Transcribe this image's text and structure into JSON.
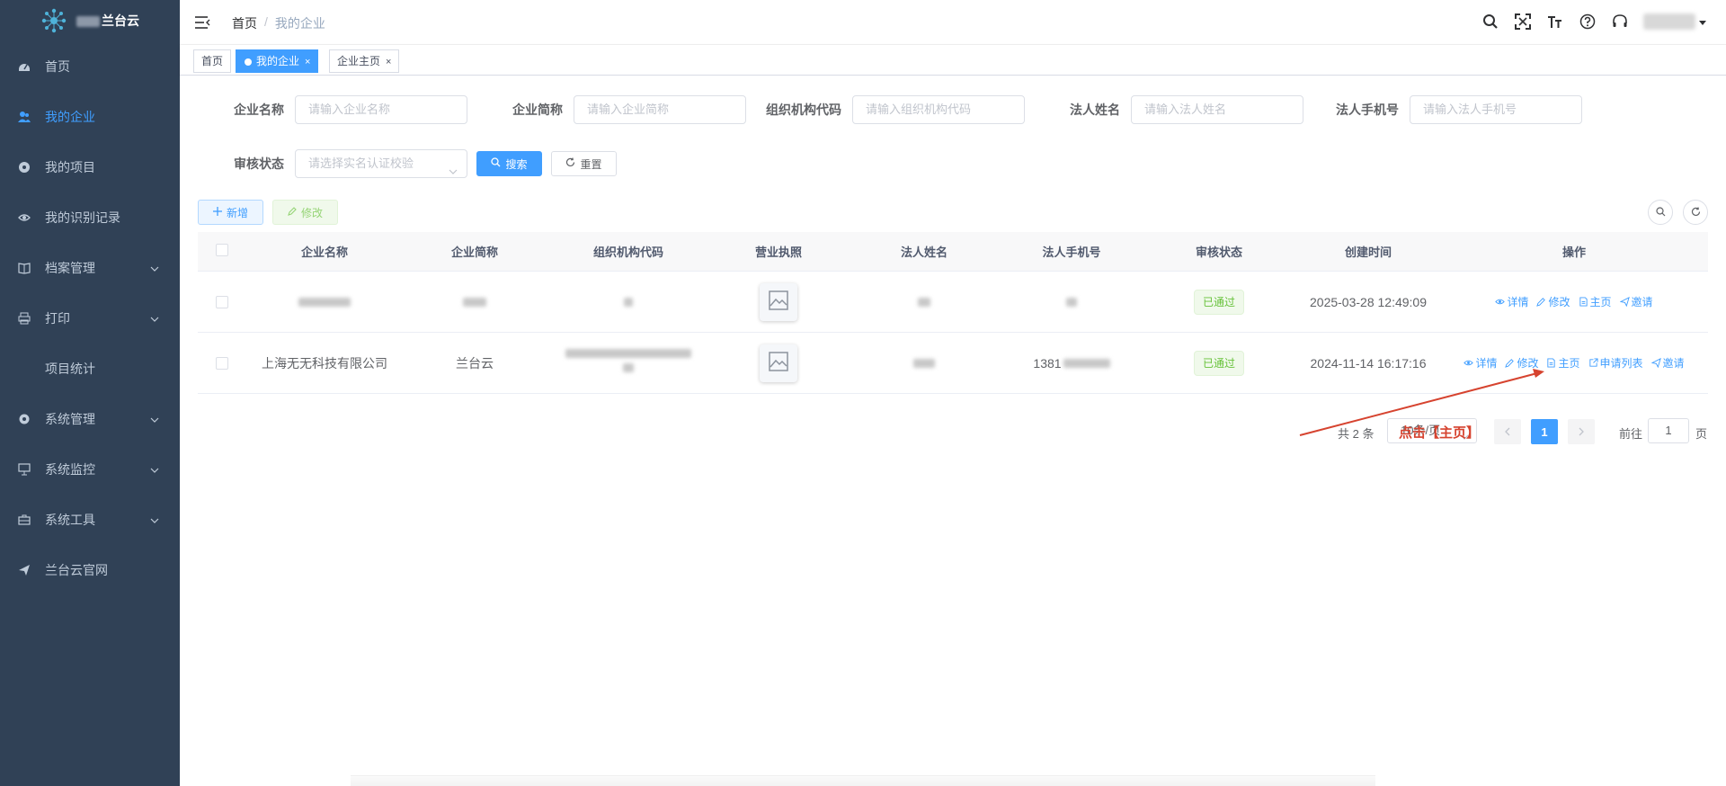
{
  "app": {
    "name": "兰台云"
  },
  "sidebar": {
    "items": [
      {
        "label": "首页",
        "icon": "dashboard-icon"
      },
      {
        "label": "我的企业",
        "icon": "users-icon"
      },
      {
        "label": "我的项目",
        "icon": "project-icon"
      },
      {
        "label": "我的识别记录",
        "icon": "eye-icon"
      },
      {
        "label": "档案管理",
        "icon": "book-icon"
      },
      {
        "label": "打印",
        "icon": "printer-icon"
      },
      {
        "label": "项目统计",
        "icon": ""
      },
      {
        "label": "系统管理",
        "icon": "gear-icon"
      },
      {
        "label": "系统监控",
        "icon": "monitor-icon"
      },
      {
        "label": "系统工具",
        "icon": "toolbox-icon"
      },
      {
        "label": "兰台云官网",
        "icon": "send-icon"
      }
    ]
  },
  "navbar": {
    "breadcrumb": [
      "首页",
      "/",
      "我的企业"
    ]
  },
  "tags": [
    {
      "label": "首页"
    },
    {
      "label": "我的企业",
      "close": "×"
    },
    {
      "label": "企业主页",
      "close": "×"
    }
  ],
  "search": {
    "fields": [
      {
        "label": "企业名称",
        "placeholder": "请输入企业名称"
      },
      {
        "label": "企业简称",
        "placeholder": "请输入企业简称"
      },
      {
        "label": "组织机构代码",
        "placeholder": "请输入组织机构代码"
      },
      {
        "label": "法人姓名",
        "placeholder": "请输入法人姓名"
      },
      {
        "label": "法人手机号",
        "placeholder": "请输入法人手机号"
      }
    ],
    "status_label": "审核状态",
    "status_placeholder": "请选择实名认证校验",
    "search_btn": "搜索",
    "reset_btn": "重置"
  },
  "toolbar": {
    "add": "新增",
    "edit": "修改"
  },
  "table": {
    "columns": [
      "企业名称",
      "企业简称",
      "组织机构代码",
      "营业执照",
      "法人姓名",
      "法人手机号",
      "审核状态",
      "创建时间",
      "操作"
    ],
    "rows": [
      {
        "name": "",
        "short": "",
        "code": "",
        "person": "",
        "phone": "",
        "status": "已通过",
        "created": "2025-03-28 12:49:09",
        "ops": [
          "详情",
          "修改",
          "主页",
          "邀请"
        ]
      },
      {
        "name": "上海无无科技有限公司",
        "short": "兰台云",
        "code": "",
        "person": "",
        "phone": "1381",
        "status": "已通过",
        "created": "2024-11-14 16:17:16",
        "ops": [
          "详情",
          "修改",
          "主页",
          "申请列表",
          "邀请"
        ]
      }
    ]
  },
  "pagination": {
    "total": "共 2 条",
    "size": "10条/页",
    "current": "1",
    "goto_label": "前往",
    "goto_value": "1",
    "page_suffix": "页"
  },
  "annotation": {
    "text": "点击【主页】",
    "color": "#d6432f"
  },
  "colors": {
    "sidebar": "#304156",
    "accent": "#409eff",
    "success": "#67c23a"
  }
}
